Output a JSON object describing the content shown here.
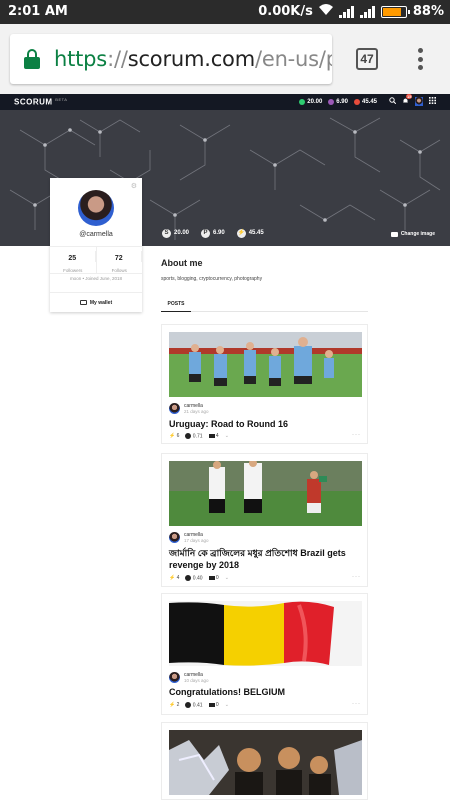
{
  "status_bar": {
    "time": "2:01 AM",
    "speed": "0.00K/s",
    "battery": "88%",
    "battery_level": 0.88
  },
  "browser": {
    "url_scheme": "https",
    "url_sep": "://",
    "url_host": "scorum.com",
    "url_path": "/en-us/pro",
    "tab_count": "47"
  },
  "site_nav": {
    "logo": "SCORUM",
    "beta": "BETA",
    "balance_scr": "20.00",
    "balance_sp": "6.90",
    "balance_power": "45.45",
    "notif_count": "15",
    "colors": {
      "scr": "#2ecc71",
      "sp": "#9b59b6",
      "power": "#e74c3c"
    }
  },
  "cover": {
    "scr": "20.00",
    "sp": "6.90",
    "power": "45.45",
    "change_image": "Change image"
  },
  "profile": {
    "username": "@carmella",
    "followers_count": "25",
    "followers_label": "Followers",
    "follows_count": "72",
    "follows_label": "Follows",
    "joined": "moon • Joined June, 2018",
    "wallet": "My wallet"
  },
  "about": {
    "title": "About me",
    "text": "sports, blogging, cryptocurrency, photography"
  },
  "tabs": {
    "posts": "POSTS"
  },
  "posts": [
    {
      "author": "carmella",
      "time": "21 days ago",
      "title": "Uruguay: Road to Round 16",
      "votes": "6",
      "payout": "0.71",
      "comments": "4",
      "image": "soccer-players-blue"
    },
    {
      "author": "carmella",
      "time": "17 days ago",
      "title": "জার্মানি কে ব্রাজিলের মধুর প্রতিশোধ Brazil gets revenge by 2018",
      "votes": "4",
      "payout": "0.40",
      "comments": "0",
      "image": "soccer-players-white-red"
    },
    {
      "author": "carmella",
      "time": "10 days ago",
      "title": "Congratulations! BELGIUM",
      "votes": "2",
      "payout": "0.41",
      "comments": "0",
      "image": "belgium-flag"
    },
    {
      "image": "rescued-boys"
    }
  ]
}
